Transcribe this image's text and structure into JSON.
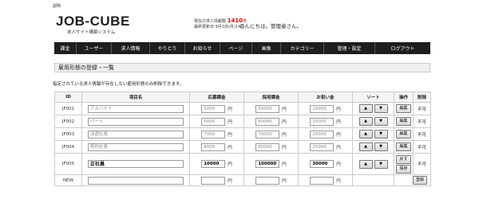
{
  "top_link": "説明",
  "logo": {
    "text": "JOB-CUBE",
    "subtitle": "求人サイト構築システム"
  },
  "header": {
    "stats_label": "現在の求人情報数",
    "stats_count": "1410",
    "stats_unit": "件",
    "updated_label": "最終更新日",
    "updated_value": "9月3日(月)14時",
    "greeting": "こんにちは。管理者さん。"
  },
  "nav": [
    {
      "label": "課金"
    },
    {
      "label": "ユーザー"
    },
    {
      "label": "求人情報"
    },
    {
      "label": "やりとり"
    },
    {
      "label": "お知らせ"
    },
    {
      "label": "ページ"
    },
    {
      "label": "画像"
    },
    {
      "label": "カテゴリー"
    },
    {
      "label": "管理・設定"
    },
    {
      "label": "ログアウト"
    }
  ],
  "section_title": "雇用形態の登録・一覧",
  "note": "指定されている求人情報が存在しない雇用形態のみ削除できます。",
  "table": {
    "headers": [
      "ID",
      "項目名",
      "応募課金",
      "採用課金",
      "お祝い金",
      "ソート",
      "操作",
      "削除"
    ],
    "unit": "円",
    "up_arrow": "▲",
    "down_arrow": "▼",
    "rows": [
      {
        "id": "JF001",
        "name": "アルバイト",
        "apply_fee": "5000",
        "hire_fee": "50000",
        "bonus": "10000",
        "action": "編集",
        "delete": "不可"
      },
      {
        "id": "JF002",
        "name": "パート",
        "apply_fee": "6000",
        "hire_fee": "60000",
        "bonus": "15000",
        "action": "編集",
        "delete": "不可"
      },
      {
        "id": "JF003",
        "name": "派遣社員",
        "apply_fee": "7000",
        "hire_fee": "70000",
        "bonus": "20000",
        "action": "編集",
        "delete": "不可"
      },
      {
        "id": "JF004",
        "name": "契約社員",
        "apply_fee": "8000",
        "hire_fee": "80000",
        "bonus": "25000",
        "action": "編集",
        "delete": "不可"
      },
      {
        "id": "JF005",
        "name": "正社員",
        "apply_fee": "10000",
        "hire_fee": "100000",
        "bonus": "30000",
        "action_back": "戻す",
        "action_save": "保存",
        "delete": "不可"
      }
    ],
    "new_row": {
      "id": "NEW",
      "action": "登録"
    }
  }
}
